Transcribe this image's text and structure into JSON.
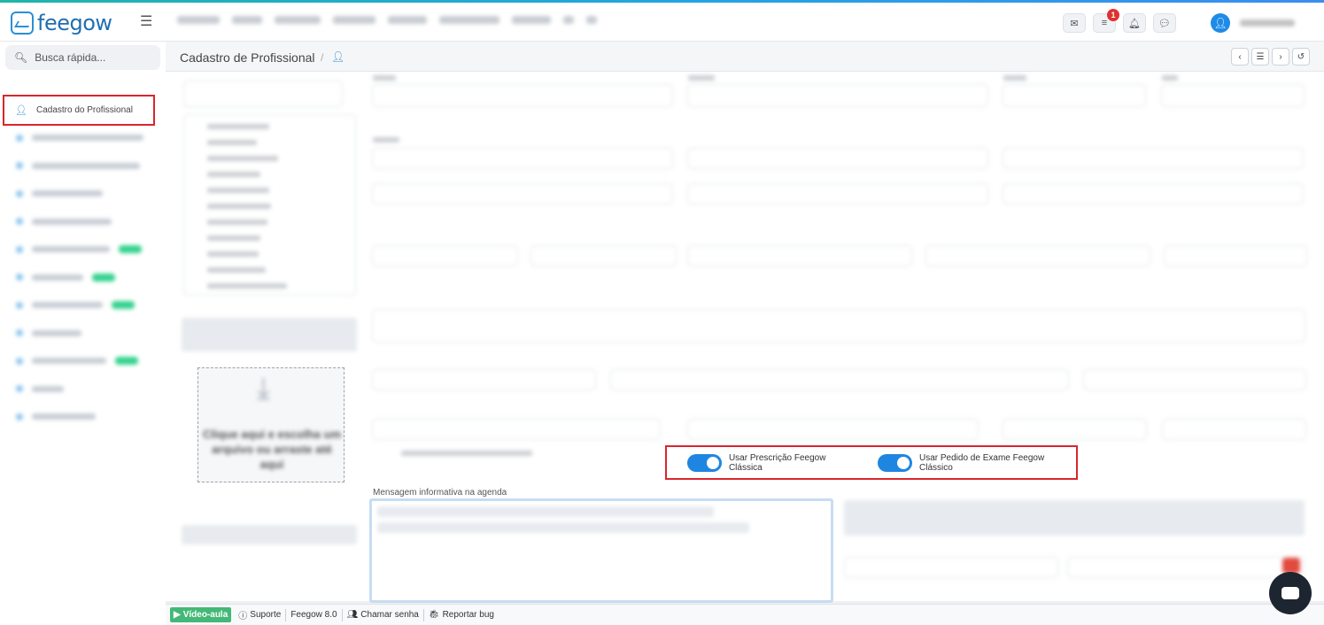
{
  "navbar": {
    "logo_text": "feegow",
    "notification_count": "1"
  },
  "sidebar": {
    "search_placeholder": "Busca rápida...",
    "active_item": "Cadastro do Profissional"
  },
  "header": {
    "title": "Cadastro de Profissional",
    "separator": "/"
  },
  "toggles": {
    "prescricao_label": "Usar Prescrição Feegow Clássica",
    "exame_label": "Usar Pedido de Exame Feegow Clássico"
  },
  "upload": {
    "text": "Clique aqui e escolha um arquivo ou arraste até aqui"
  },
  "editor": {
    "label": "Mensagem informativa na agenda"
  },
  "footer": {
    "video": "Vídeo-aula",
    "support": "Suporte",
    "version": "Feegow 8.0",
    "call": "Chamar senha",
    "bug": "Reportar bug"
  },
  "colors": {
    "accent": "#1e86e0",
    "highlight_outline": "#d9262c",
    "new_badge": "#35d28f"
  }
}
